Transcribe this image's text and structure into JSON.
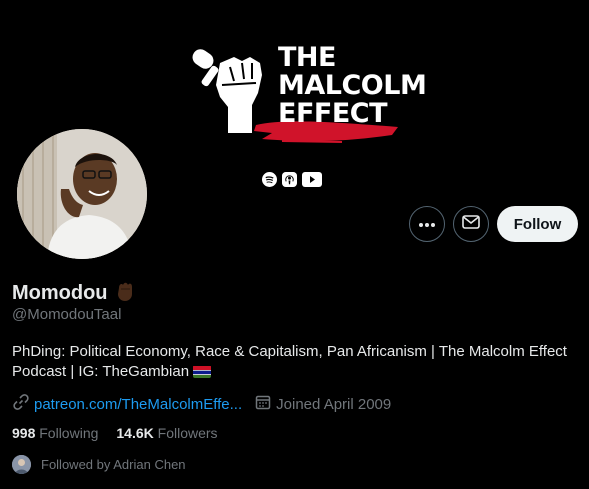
{
  "banner": {
    "logo_line1": "THE",
    "logo_line2": "MALCOLM",
    "logo_line3": "EFFECT",
    "platform_icons": [
      "spotify-icon",
      "apple-podcasts-icon",
      "youtube-icon"
    ]
  },
  "actions": {
    "more_icon": "more-horizontal-icon",
    "message_icon": "envelope-icon",
    "follow_label": "Follow"
  },
  "profile": {
    "display_name": "Momodou",
    "name_emoji": "✊🏿",
    "handle": "@MomodouTaal",
    "bio": "PhDing: Political Economy, Race & Capitalism, Pan Africanism | The Malcolm Effect Podcast | IG: TheGambian",
    "link": "patreon.com/TheMalcolmEffe...",
    "joined": "Joined April 2009",
    "following_count": "998",
    "following_label": "Following",
    "followers_count": "14.6K",
    "followers_label": "Followers",
    "followed_by": "Followed by Adrian Chen"
  },
  "colors": {
    "background": "#000000",
    "link": "#1d9bf0",
    "muted": "#71767b",
    "text": "#e7e9ea",
    "brush_red": "#d0132a"
  }
}
